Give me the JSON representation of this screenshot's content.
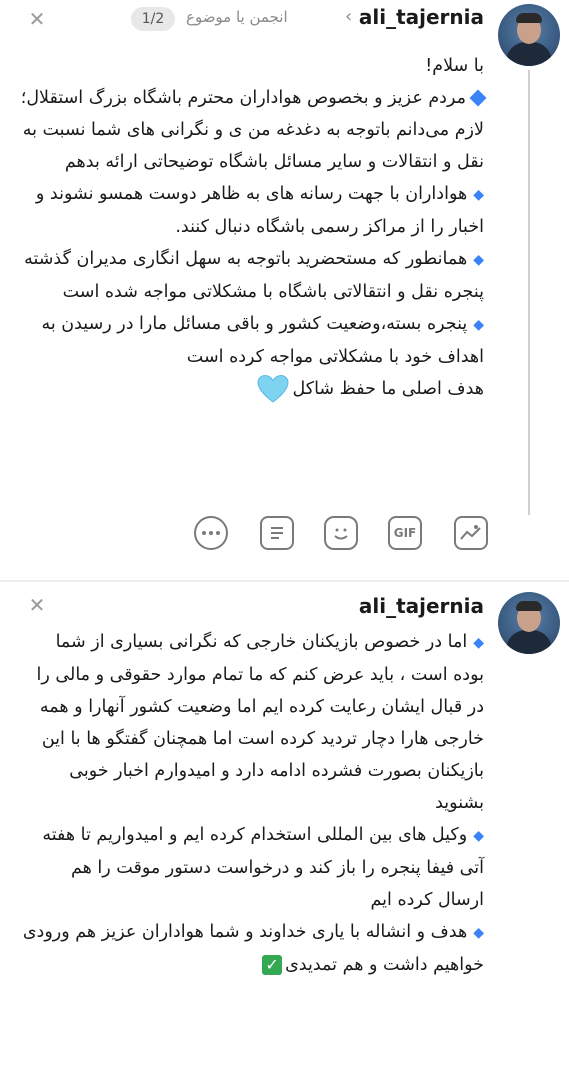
{
  "posts": [
    {
      "username": "ali_tajernia",
      "breadcrumb_topic": "انجمن یا موضوع",
      "page_indicator": "1/2",
      "paragraphs": [
        "با سلام!",
        "مردم عزیز و بخصوص هواداران محترم باشگاه بزرگ استقلال؛ لازم می‌دانم باتوجه به دغدغه من ی و نگرانی های شما نسبت به نقل و انتقالات و سایر مسائل باشگاه توضیحاتی ارائه بدهم",
        "هواداران با جهت رسانه های به ظاهر دوست همسو نشوند و اخبار را از مراکز رسمی باشگاه دنبال کنند.",
        "همانطور که مستحضرید باتوجه به سهل انگاری مدیران گذشته پنجره نقل و انتقالاتی باشگاه با مشکلاتی مواجه شده است",
        "پنجره بسته،وضعیت کشور و باقی مسائل مارا در رسیدن به اهداف خود با مشکلاتی مواجه کرده است",
        "هدف اصلی ما حفظ شاکل"
      ],
      "toolbar_icons": [
        "image-icon",
        "gif-icon",
        "sticker-icon",
        "note-icon",
        "more-icon"
      ],
      "gif_label": "GIF"
    },
    {
      "username": "ali_tajernia",
      "paragraphs": [
        "اما در خصوص بازیکنان خارجی که نگرانی بسیاری از شما بوده است ، باید عرض کنم که ما تمام موارد حقوقی و مالی را در قبال ایشان رعایت کرده ایم اما وضعیت کشور آنهارا و همه خارجی هارا دچار تردید کرده است اما همچنان گفتگو ها با این بازیکنان بصورت فشرده ادامه دارد و امیدوارم اخبار خوبی بشنوید",
        "وکیل های بین المللی استخدام کرده ایم و امیدواریم تا هفته آتی فیفا پنجره را باز کند و درخواست دستور موقت را هم ارسال کرده ایم",
        "هدف و انشاله با یاری خداوند و شما هواداران عزیز هم ورودی خواهیم داشت و هم تمدیدی"
      ]
    }
  ],
  "colors": {
    "accent": "#3b82f6",
    "heart": "#7dd3f0",
    "check": "#34a853"
  }
}
